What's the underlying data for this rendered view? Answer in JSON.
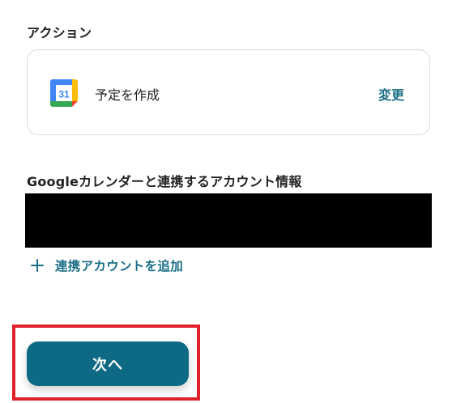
{
  "action_section": {
    "label": "アクション",
    "card": {
      "icon": "google-calendar-icon",
      "icon_number": "31",
      "title": "予定を作成",
      "change_label": "変更"
    }
  },
  "account_section": {
    "label": "Googleカレンダーと連携するアカウント情報",
    "add_account_label": "連携アカウントを追加"
  },
  "footer": {
    "next_label": "次へ"
  },
  "colors": {
    "accent": "#1c6f87",
    "button": "#0e6a84",
    "highlight": "#e0202a",
    "redaction": "#000000"
  }
}
